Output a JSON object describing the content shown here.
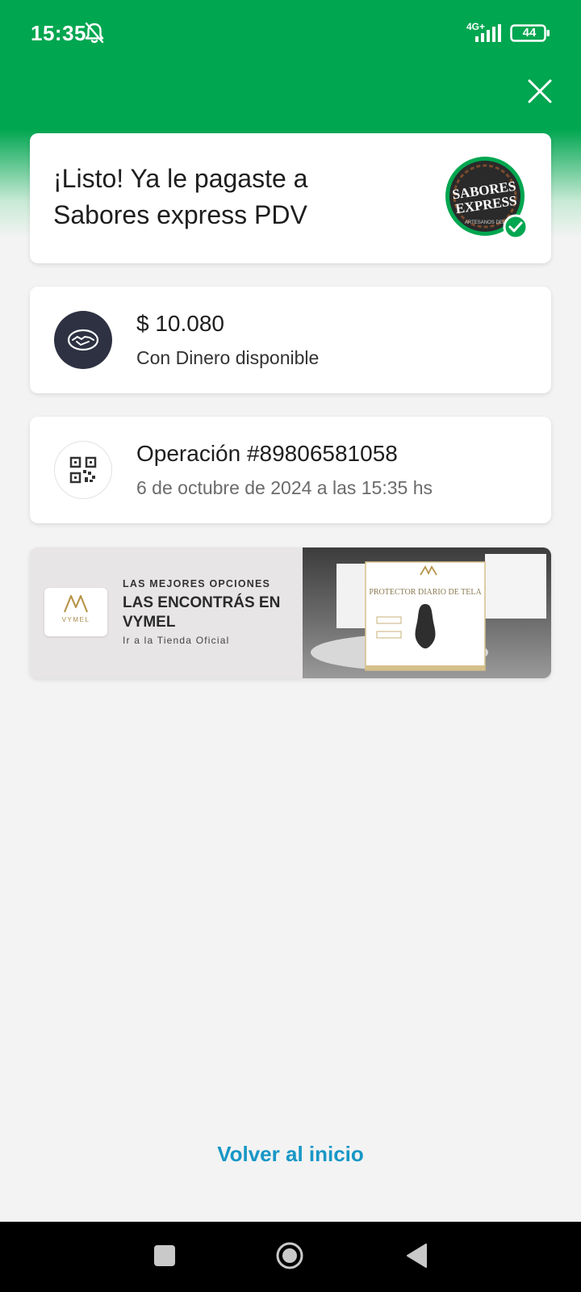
{
  "status_bar": {
    "time": "15:35",
    "network": "4G+",
    "battery": "44",
    "icons": [
      "bell-off-icon",
      "signal-icon",
      "battery-icon"
    ]
  },
  "header": {
    "close_icon": "close-icon"
  },
  "success": {
    "title": "¡Listo! Ya le pagaste a Sabores express PDV",
    "merchant_logo": {
      "line1": "SABORES",
      "line2": "EXPRESS",
      "tagline": "ARTESANOS DEL"
    }
  },
  "payment": {
    "amount": "$ 10.080",
    "method": "Con Dinero disponible",
    "icon": "handshake-icon"
  },
  "operation": {
    "number": "Operación #89806581058",
    "datetime": "6 de octubre de 2024 a las 15:35 hs",
    "icon": "qr-code-icon"
  },
  "banner": {
    "brand": "VYMEL",
    "kicker": "LAS MEJORES OPCIONES",
    "title": "LAS ENCONTRÁS EN VYMEL",
    "cta": "Ir a la Tienda Oficial",
    "product_label": "PROTECTOR DIARIO DE TELA"
  },
  "footer": {
    "home_link": "Volver al inicio"
  },
  "nav": {
    "icons": [
      "recents-icon",
      "home-icon",
      "back-icon"
    ]
  },
  "colors": {
    "brand_green": "#00a650",
    "link_blue": "#1797c6",
    "dark_avatar": "#2d3142"
  }
}
